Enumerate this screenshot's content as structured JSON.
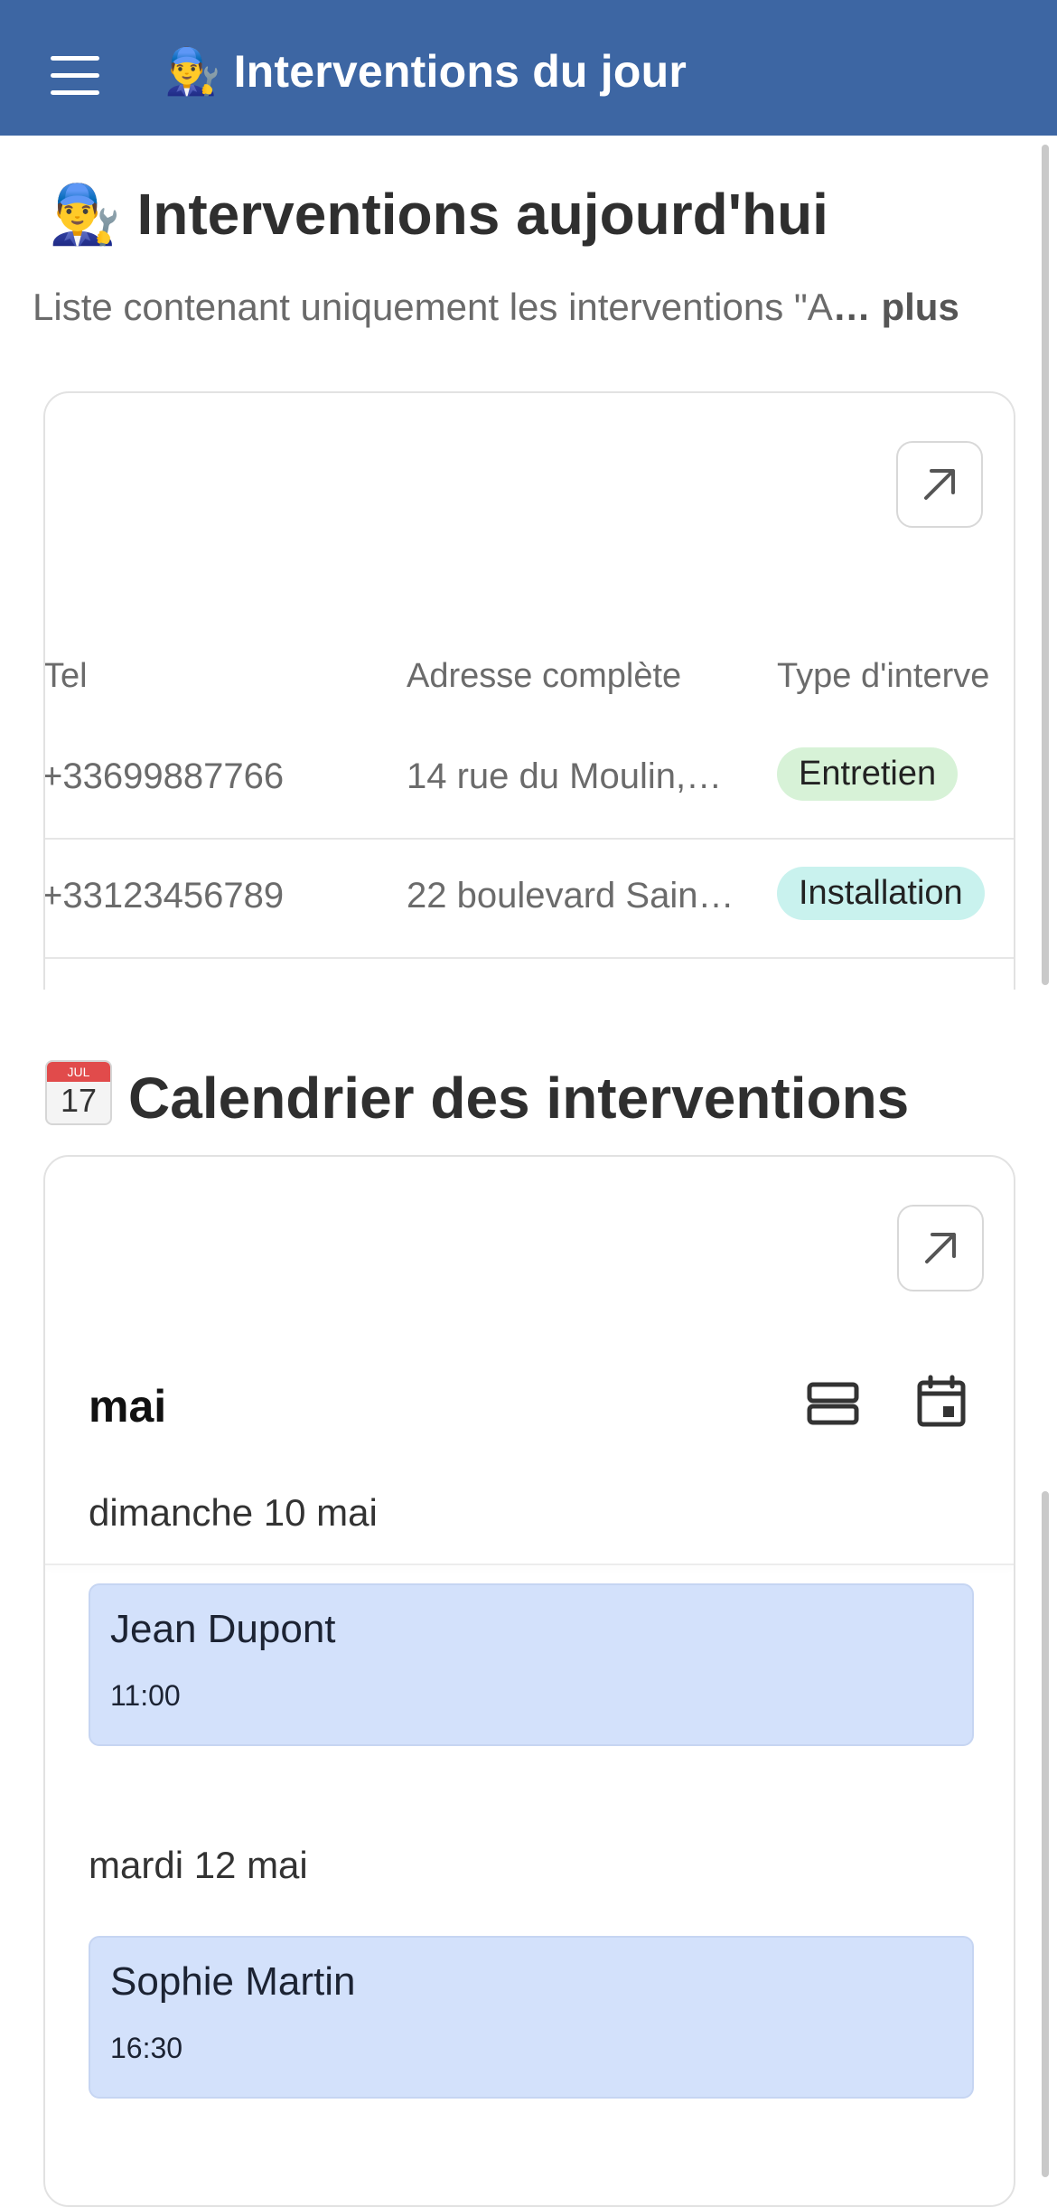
{
  "header": {
    "title": "Interventions du jour",
    "emoji": "👨‍🔧"
  },
  "section1": {
    "emoji": "👨‍🔧",
    "title": "Interventions aujourd'hui",
    "description": "Liste contenant uniquement les interventions \"A",
    "more": "… plus",
    "table": {
      "headers": [
        "Tel",
        "Adresse complète",
        "Type d'interve"
      ],
      "rows": [
        {
          "tel": "+33699887766",
          "adresse": "14 rue du Moulin,…",
          "type": "Entretien",
          "type_color": "#d7f2d7"
        },
        {
          "tel": "+33123456789",
          "adresse": "22 boulevard Sain…",
          "type": "Installation",
          "type_color": "#c9f2ee"
        }
      ]
    }
  },
  "section2": {
    "calendar_icon": {
      "month": "JUL",
      "day": "17"
    },
    "title": "Calendrier des interventions",
    "month": "mai",
    "days": [
      {
        "label": "dimanche 10 mai",
        "event": {
          "name": "Jean Dupont",
          "time": "11:00"
        }
      },
      {
        "label": "mardi 12 mai",
        "event": {
          "name": "Sophie Martin",
          "time": "16:30"
        }
      }
    ]
  },
  "colors": {
    "header_bg": "#3d66a3",
    "event_bg": "#d3e1fb",
    "tag_entretien": "#d7f2d7",
    "tag_installation": "#c9f2ee"
  }
}
